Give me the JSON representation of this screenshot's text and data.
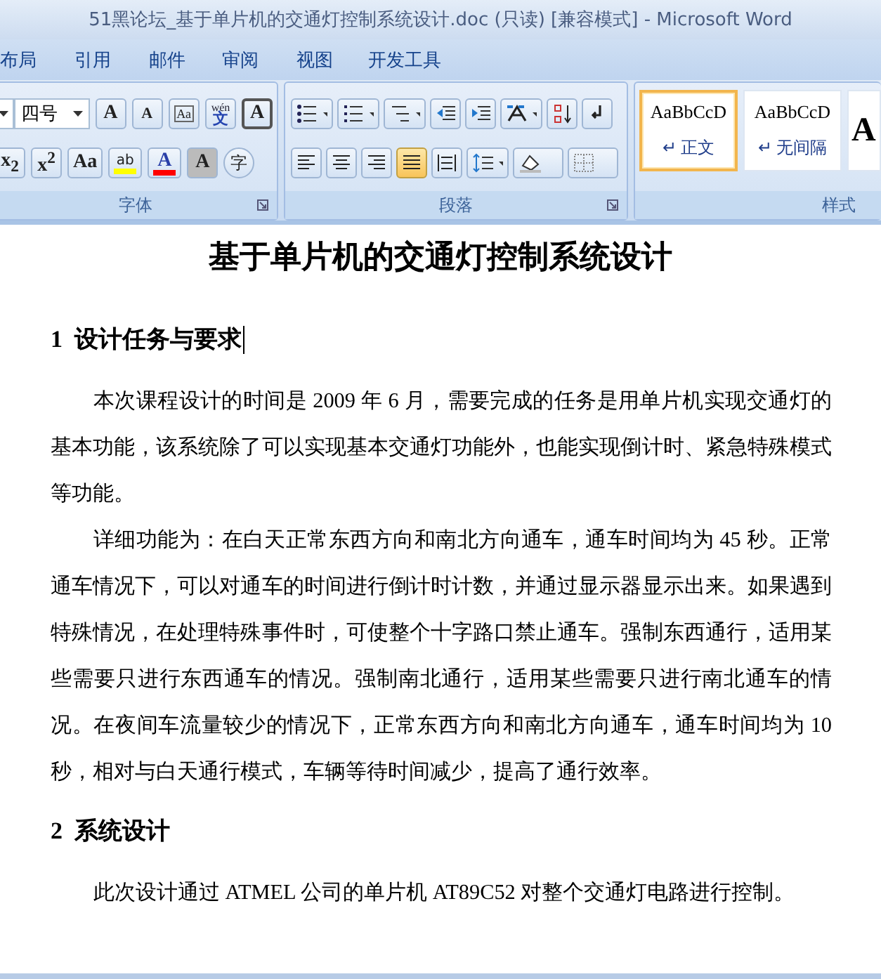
{
  "window": {
    "title": "51黑论坛_基于单片机的交通灯控制系统设计.doc (只读) [兼容模式] - Microsoft Word"
  },
  "tabs": [
    {
      "label": "布局",
      "selected": false
    },
    {
      "label": "引用",
      "selected": false
    },
    {
      "label": "邮件",
      "selected": false
    },
    {
      "label": "审阅",
      "selected": false
    },
    {
      "label": "视图",
      "selected": false
    },
    {
      "label": "开发工具",
      "selected": false
    }
  ],
  "font_group": {
    "label": "字体",
    "size": "四号",
    "row1": [
      {
        "kind": "grow",
        "label": "A"
      },
      {
        "kind": "shrink",
        "label": "A"
      },
      {
        "kind": "clear",
        "label": "Aa"
      },
      {
        "kind": "phonetic",
        "label": "wén",
        "sub": "文"
      },
      {
        "kind": "boxed",
        "label": "A"
      }
    ],
    "row2": [
      {
        "kind": "plain",
        "label": "x$_{2}$"
      },
      {
        "kind": "plain",
        "label": "x$^{2}$"
      },
      {
        "kind": "case",
        "label": "Aa"
      },
      {
        "kind": "highlight",
        "label": "ab",
        "color": "#ffff00"
      },
      {
        "kind": "fontcolor",
        "label": "A",
        "color": "#ff0000"
      },
      {
        "kind": "shaded",
        "label": "A"
      },
      {
        "kind": "circled",
        "label": "字"
      }
    ]
  },
  "paragraph_group": {
    "label": "段落",
    "align": [
      {
        "kind": "left",
        "selected": false
      },
      {
        "kind": "center",
        "selected": false
      },
      {
        "kind": "right",
        "selected": false
      },
      {
        "kind": "justify",
        "selected": true
      },
      {
        "kind": "distributed",
        "selected": false
      }
    ]
  },
  "styles_group": {
    "label": "样式",
    "styles": [
      {
        "preview": "AaBbCcD",
        "name": "↵ 正文",
        "selected": true
      },
      {
        "preview": "AaBbCcD",
        "name": "↵ 无间隔",
        "selected": false
      },
      {
        "preview": "A",
        "selected": false
      }
    ]
  },
  "document": {
    "title": "基于单片机的交通灯控制系统设计",
    "blocks": [
      {
        "kind": "heading",
        "text": "1  设计任务与要求",
        "cursor": true
      },
      {
        "kind": "para",
        "text": "本次课程设计的时间是 2009 年 6 月，需要完成的任务是用单片机实现交通灯的基本功能，该系统除了可以实现基本交通灯功能外，也能实现倒计时、紧急特殊模式等功能。"
      },
      {
        "kind": "para",
        "text": "详细功能为：在白天正常东西方向和南北方向通车，通车时间均为 45 秒。正常通车情况下，可以对通车的时间进行倒计时计数，并通过显示器显示出来。如果遇到特殊情况，在处理特殊事件时，可使整个十字路口禁止通车。强制东西通行，适用某些需要只进行东西通车的情况。强制南北通行，适用某些需要只进行南北通车的情况。在夜间车流量较少的情况下，正常东西方向和南北方向通车，通车时间均为 10 秒，相对与白天通行模式，车辆等待时间减少，提高了通行效率。"
      },
      {
        "kind": "heading",
        "text": "2  系统设计",
        "cursor": false
      },
      {
        "kind": "para",
        "text": "此次设计通过 ATMEL 公司的单片机 AT89C52 对整个交通灯电路进行控制。"
      }
    ]
  }
}
